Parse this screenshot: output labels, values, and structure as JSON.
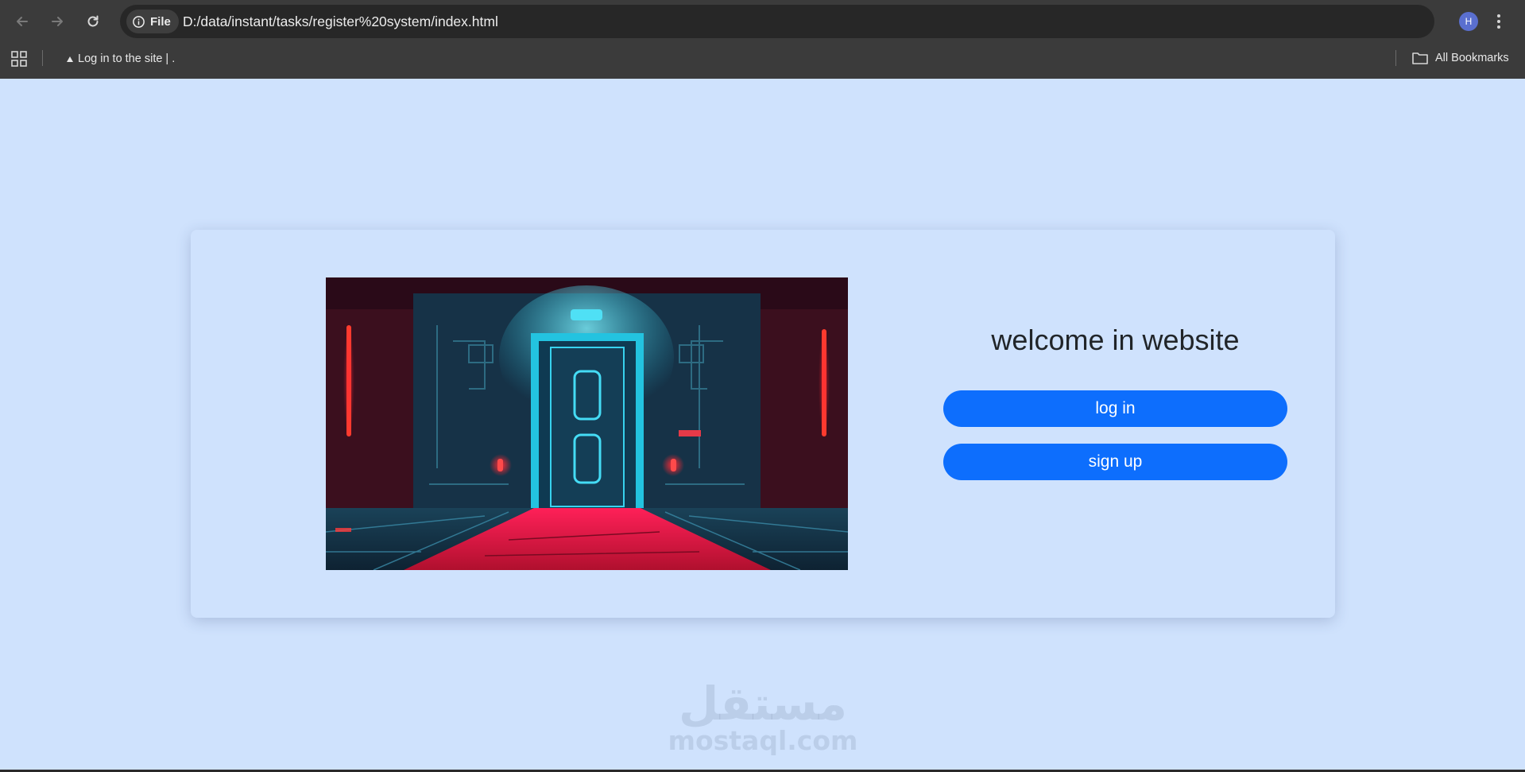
{
  "browser": {
    "site_chip_label": "File",
    "url": "D:/data/instant/tasks/register%20system/index.html",
    "avatar_letter": "H",
    "bookmarks": {
      "item_label": "Log in to the site | .",
      "all_bookmarks_label": "All Bookmarks"
    }
  },
  "page": {
    "heading": "welcome in website",
    "login_label": "log in",
    "signup_label": "sign up",
    "hero_image": "futuristic-door-illustration",
    "watermark": {
      "arabic": "مستقل",
      "latin": "mostaql.com"
    }
  },
  "colors": {
    "page_background": "#cfe2fd",
    "primary_button": "#0d6efd",
    "chrome": "#3b3b3b"
  }
}
